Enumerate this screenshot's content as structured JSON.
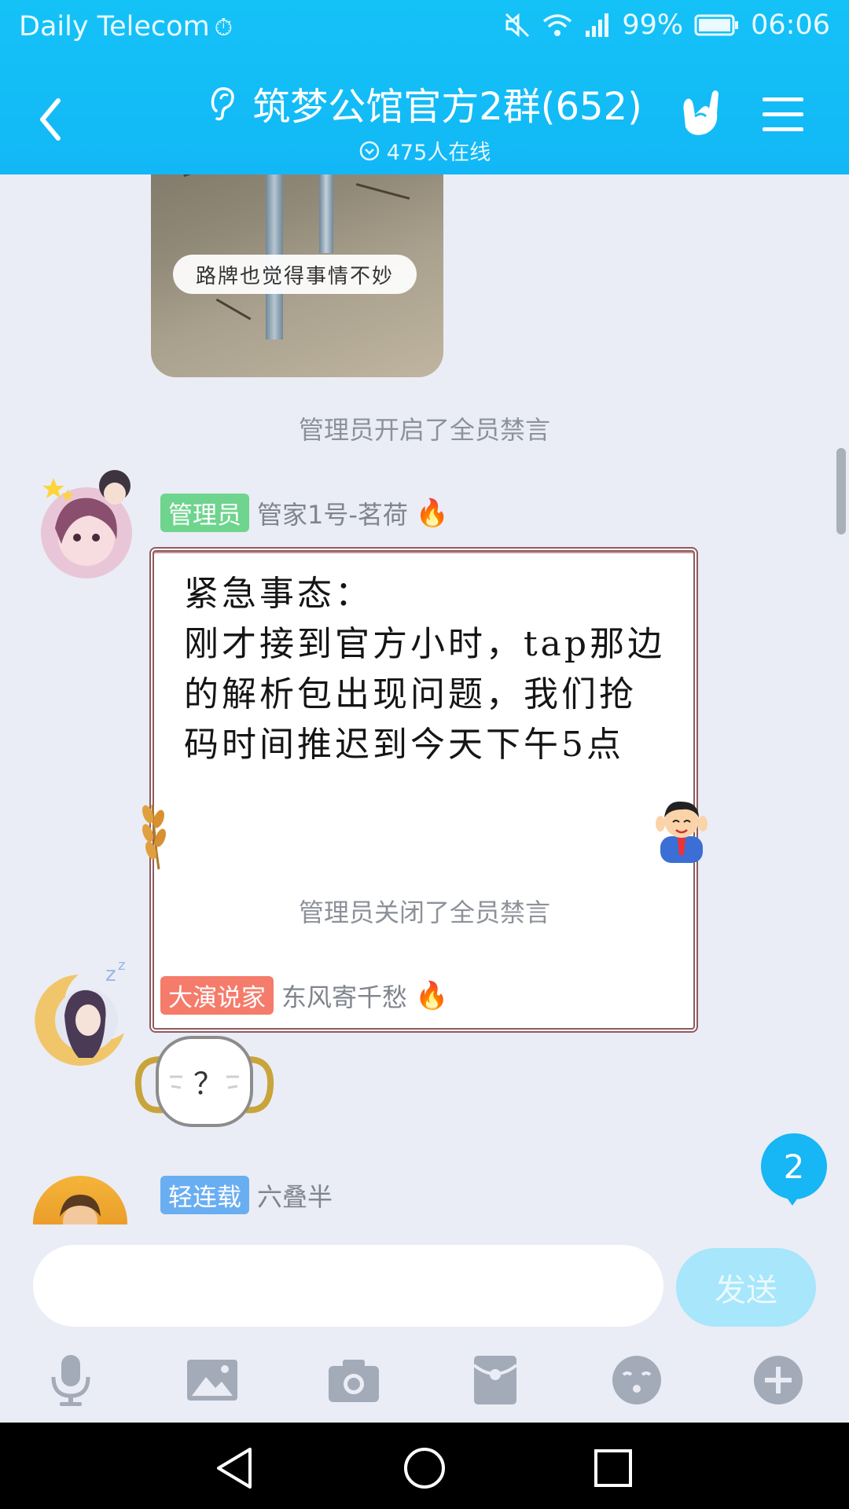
{
  "status_bar": {
    "carrier": "Daily Telecom",
    "battery": "99%",
    "time": "06:06"
  },
  "header": {
    "title": "筑梦公馆官方2群(652)",
    "online": "475人在线"
  },
  "chat": {
    "photo_caption": "路牌也觉得事情不妙",
    "system_msg_1": "管理员开启了全员禁言",
    "system_msg_2": "管理员关闭了全员禁言",
    "messages": [
      {
        "badge": "管理员",
        "sender": "管家1号-茗荷",
        "text": "紧急事态：\n刚才接到官方小时，tap那边的解析包出现问题，我们抢码时间推迟到今天下午5点"
      },
      {
        "badge": "大演说家",
        "sender": "东风寄千愁",
        "sticker_text": "？"
      },
      {
        "badge": "轻连载",
        "sender": "六叠半"
      }
    ],
    "unread_count": "2"
  },
  "input": {
    "placeholder": "",
    "send_label": "发送"
  },
  "colors": {
    "header_blue": "#14c2f7",
    "badge_admin": "#6ed48e",
    "badge_speaker": "#f57b6b",
    "badge_serial": "#6aaef2"
  },
  "icons": {
    "toolbar": [
      "microphone-icon",
      "image-icon",
      "camera-icon",
      "red-packet-icon",
      "emoji-icon",
      "plus-icon"
    ]
  }
}
